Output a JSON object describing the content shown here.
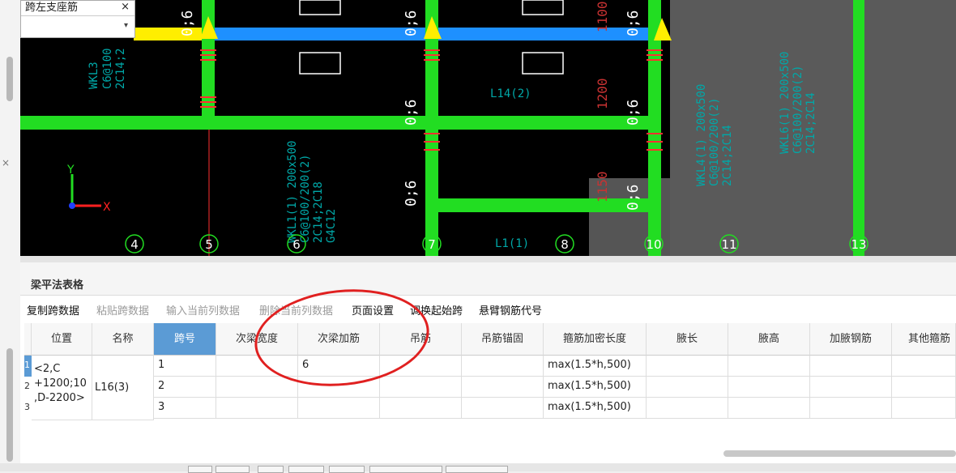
{
  "dropdown": {
    "title": "跨左支座筋",
    "close": "×",
    "value": ""
  },
  "cad": {
    "beam_labels": [
      "WKL3",
      "C6@100",
      "2C14;2",
      "L16(3)",
      "L14(2)",
      "L1(1)",
      "WKL1(1) 200x500",
      "C6@100/200(2)",
      "2C14;2C18",
      "G4C12",
      "WKL4(1) 200x500",
      "C6@100/200(2)",
      "2C14;2C14",
      "WKL6(1) 200x500",
      "C6@100/200(2)",
      "2C14;2C14"
    ],
    "dim_labels": [
      "0;6",
      "0;6",
      "0;6",
      "0;6",
      "0;6",
      "0;6",
      "0;6",
      "0;6"
    ],
    "vertical_dims": [
      "1100",
      "1200",
      "1150"
    ],
    "axis_numbers": [
      "4",
      "5",
      "6",
      "7",
      "8",
      "10",
      "11",
      "13"
    ],
    "axis_labels": {
      "x": "X",
      "y": "Y"
    }
  },
  "panel": {
    "title": "梁平法表格",
    "toolbar": [
      {
        "label": "复制跨数据",
        "enabled": true
      },
      {
        "label": "粘贴跨数据",
        "enabled": false
      },
      {
        "label": "输入当前列数据",
        "enabled": false
      },
      {
        "label": "删除当前列数据",
        "enabled": false
      },
      {
        "label": "页面设置",
        "enabled": true
      },
      {
        "label": "调换起始跨",
        "enabled": true
      },
      {
        "label": "悬臂钢筋代号",
        "enabled": true
      }
    ],
    "columns": [
      "位置",
      "名称",
      "跨号",
      "次梁宽度",
      "次梁加筋",
      "吊筋",
      "吊筋锚固",
      "箍筋加密长度",
      "腋长",
      "腋高",
      "加腋钢筋",
      "其他箍筋"
    ],
    "selected_column": "跨号",
    "position_value": [
      "<2,C",
      "+1200;10",
      ",D-2200>"
    ],
    "name_value": "L16(3)",
    "row_numbers": [
      "1",
      "2",
      "3"
    ],
    "rows": [
      {
        "span": "1",
        "secondary_width": "",
        "secondary_rebar": "6",
        "hanger": "",
        "hanger_anchor": "",
        "stirrup_length": "max(1.5*h,500)"
      },
      {
        "span": "2",
        "secondary_width": "",
        "secondary_rebar": "",
        "hanger": "",
        "hanger_anchor": "",
        "stirrup_length": "max(1.5*h,500)"
      },
      {
        "span": "3",
        "secondary_width": "",
        "secondary_rebar": "",
        "hanger": "",
        "hanger_anchor": "",
        "stirrup_length": "max(1.5*h,500)"
      }
    ]
  },
  "colors": {
    "beam_green": "#22dd22",
    "beam_blue": "#1e90ff",
    "beam_yellow": "#ffee00",
    "annotation_red": "#e02020",
    "cad_text": "#00a8a8"
  }
}
